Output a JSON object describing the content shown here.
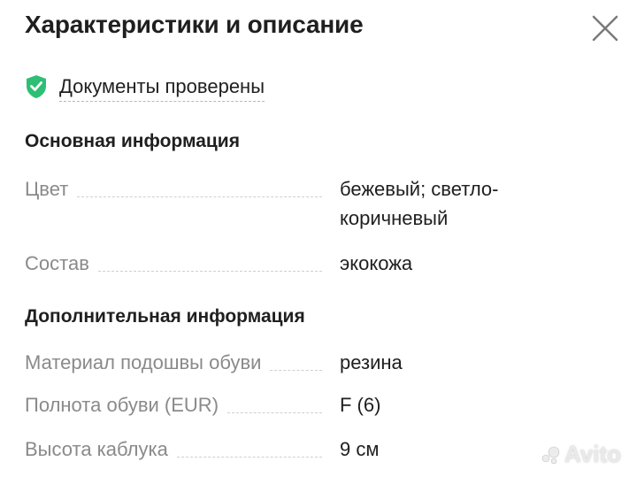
{
  "header": {
    "title": "Характеристики и описание",
    "close_icon": "close-icon"
  },
  "verified": {
    "label": "Документы проверены",
    "icon": "shield-check-icon",
    "color": "#2dbf74"
  },
  "sections": [
    {
      "title": "Основная информация",
      "rows": [
        {
          "key": "Цвет",
          "value": "бежевый; светло-коричневый"
        },
        {
          "key": "Состав",
          "value": "экокожа"
        }
      ]
    },
    {
      "title": "Дополнительная информация",
      "rows": [
        {
          "key": "Материал подошвы обуви",
          "value": "резина"
        },
        {
          "key": "Полнота обуви (EUR)",
          "value": "F (6)"
        },
        {
          "key": "Высота каблука",
          "value": "9 см"
        }
      ]
    }
  ],
  "watermark": {
    "text": "Avito"
  }
}
